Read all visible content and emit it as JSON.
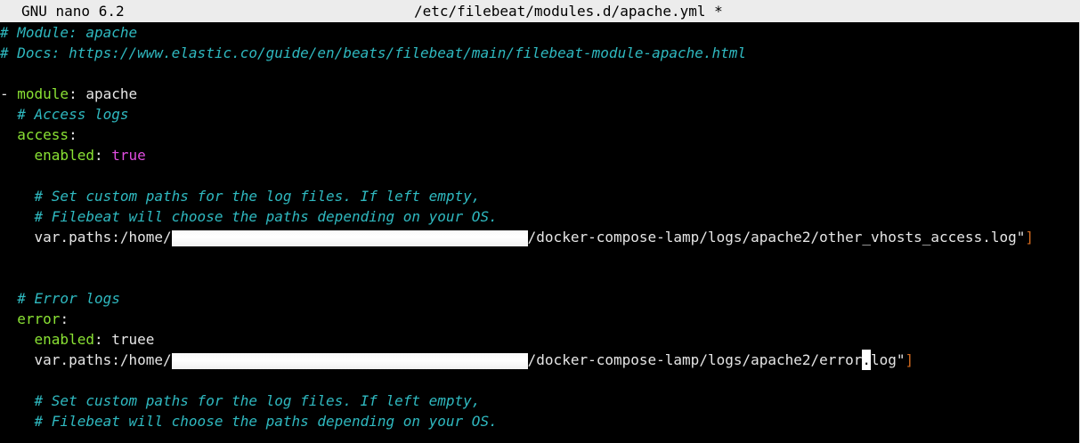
{
  "title_bar": {
    "app_name": "GNU nano 6.2",
    "file_path": "/etc/filebeat/modules.d/apache.yml *"
  },
  "editor": {
    "line_module_comment": "# Module: apache",
    "line_docs_comment": "# Docs: https://www.elastic.co/guide/en/beats/filebeat/main/filebeat-module-apache.html",
    "module_dash": "- ",
    "module_key": "module",
    "module_value": "apache",
    "access_comment": "# Access logs",
    "access_key": "access",
    "access_enabled_key": "enabled",
    "access_enabled_value": "true",
    "custom_paths_comment_1": "# Set custom paths for the log files. If left empty,",
    "custom_paths_comment_2": "# Filebeat will choose the paths depending on your OS.",
    "access_var_prefix": "var.paths:/home/",
    "access_var_suffix": "/docker-compose-lamp/logs/apache2/other_vhosts_access.log\"",
    "access_bracket": "]",
    "error_comment": "# Error logs",
    "error_key": "error",
    "error_enabled_key": "enabled",
    "error_enabled_value": "truee",
    "error_var_prefix": "var.paths:/home/",
    "error_var_suffix_a": "/docker-compose-lamp/logs/apache2/error",
    "error_var_cursor_char": ".",
    "error_var_suffix_b": "log\"",
    "error_bracket": "]",
    "error_custom_paths_comment_1": "# Set custom paths for the log files. If left empty,",
    "error_custom_paths_comment_2": "# Filebeat will choose the paths depending on your OS."
  },
  "colors": {
    "comment": "#2fb9c0",
    "key": "#8ae234",
    "boolean": "#e04de0",
    "bracket": "#d2691e",
    "background": "#000000",
    "title_bar": "#ececec"
  }
}
